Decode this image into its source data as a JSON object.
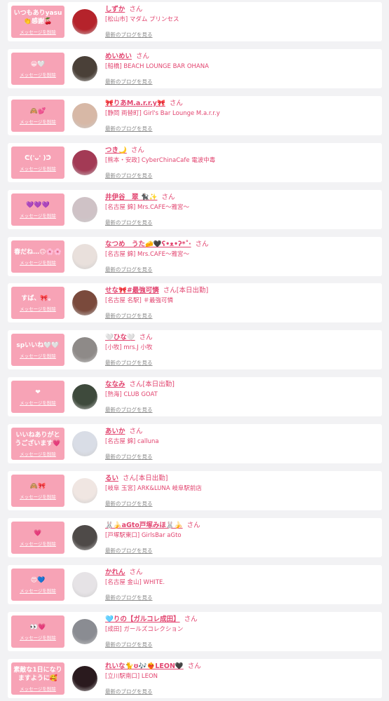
{
  "colors": {
    "page_bg": "#f2f2f4",
    "card_bg": "#ffffff",
    "badge_bg": "#f7a3b6",
    "accent": "#e2446f",
    "muted": "#8a8a8a"
  },
  "entries": [
    {
      "badge": "いつもありyasu👏感謝🍒",
      "delete_label": "メッセージを削除",
      "name": "しずか",
      "honorific": "さん",
      "shop": "[松山市] マダム プリンセス",
      "blog_label": "最新のブログを見る",
      "avatar_icon": "avatar-photo",
      "avatar_color": "#b5232b"
    },
    {
      "badge": "😀🤍",
      "delete_label": "メッセージを削除",
      "name": "めいめい",
      "honorific": "さん",
      "shop": "[船橋] BEACH LOUNGE BAR OHANA",
      "blog_label": "最新のブログを見る",
      "avatar_icon": "avatar-photo",
      "avatar_color": "#4a4038"
    },
    {
      "badge": "🙈💕",
      "delete_label": "メッセージを削除",
      "name": "🎀りあM.a.r.r.y🎀",
      "honorific": "さん",
      "shop": "[静岡 両替町] Girl's Bar Lounge M.a.r.r.y",
      "blog_label": "最新のブログを見る",
      "avatar_icon": "avatar-photo",
      "avatar_color": "#d7b8a6"
    },
    {
      "badge": "ᕦ('ᴗ' )ᕤ",
      "delete_label": "メッセージを削除",
      "name": "つき🌙",
      "honorific": "さん",
      "shop": "[熊本・安政] CyberChinaCafe 電波中毒",
      "blog_label": "最新のブログを見る",
      "avatar_icon": "avatar-photo",
      "avatar_color": "#a33a55"
    },
    {
      "badge": "💜💜💜",
      "delete_label": "メッセージを削除",
      "name": "井伊谷　翠 🐈‍⬛✨",
      "honorific": "さん",
      "shop": "[名古屋 錦] Mrs.CAFE〜雅宮〜",
      "blog_label": "最新のブログを見る",
      "avatar_icon": "avatar-photo",
      "avatar_color": "#cfc2c6"
    },
    {
      "badge": "春だね…🙃🌸🌸",
      "delete_label": "メッセージを削除",
      "name": "なつめ　うた🧀🖤ʕ•ᴥ•ʔ*˚‧",
      "honorific": "さん",
      "shop": "[名古屋 錦] Mrs.CAFE〜雅宮〜",
      "blog_label": "最新のブログを見る",
      "avatar_icon": "avatar-photo",
      "avatar_color": "#e9e0dc"
    },
    {
      "badge": "すば、🎀。",
      "delete_label": "メッセージを削除",
      "name": "せな🎀#最強可憐",
      "honorific": "さん[本日出勤]",
      "shop": "[名古屋 名駅] ＃最強可憐",
      "blog_label": "最新のブログを見る",
      "avatar_icon": "avatar-photo",
      "avatar_color": "#7a4a3c"
    },
    {
      "badge": "spいいね🤍🤍",
      "delete_label": "メッセージを削除",
      "name": "🤍ひな🤍",
      "honorific": "さん",
      "shop": "[小牧] mrs.J 小牧",
      "blog_label": "最新のブログを見る",
      "avatar_icon": "avatar-photo",
      "avatar_color": "#8e8a88"
    },
    {
      "badge": "❤",
      "delete_label": "メッセージを削除",
      "name": "ななみ",
      "honorific": "さん[本日出勤]",
      "shop": "[熱海] CLUB GOAT",
      "blog_label": "最新のブログを見る",
      "avatar_icon": "avatar-photo",
      "avatar_color": "#3e4a3c"
    },
    {
      "badge": "いいねありがとうございます💗",
      "delete_label": "メッセージを削除",
      "name": "あいか",
      "honorific": "さん",
      "shop": "[名古屋 錦] calluna",
      "blog_label": "最新のブログを見る",
      "avatar_icon": "avatar-photo",
      "avatar_color": "#d9dde6"
    },
    {
      "badge": "🙈🎀",
      "delete_label": "メッセージを削除",
      "name": "るい",
      "honorific": "さん[本日出勤]",
      "shop": "[岐阜 玉宮] ARK&LUNA 岐阜駅前店",
      "blog_label": "最新のブログを見る",
      "avatar_icon": "avatar-photo",
      "avatar_color": "#f0e6e2"
    },
    {
      "badge": "💗",
      "delete_label": "メッセージを削除",
      "name": "🐰🍌aGto戸塚みほ🐰🍌",
      "honorific": "さん",
      "shop": "[戸塚駅東口] GirlsBar aGto",
      "blog_label": "最新のブログを見る",
      "avatar_icon": "avatar-photo",
      "avatar_color": "#4e4a48"
    },
    {
      "badge": "😍💙",
      "delete_label": "メッセージを削除",
      "name": "かれん",
      "honorific": "さん",
      "shop": "[名古屋 金山] WHITE.",
      "blog_label": "最新のブログを見る",
      "avatar_icon": "avatar-photo",
      "avatar_color": "#e6e3e6"
    },
    {
      "badge": "👀💗",
      "delete_label": "メッセージを削除",
      "name": "🩵りの【ガルコレ成田】",
      "honorific": "さん",
      "shop": "[成田] ガールズコレクション",
      "blog_label": "最新のブログを見る",
      "avatar_icon": "avatar-photo",
      "avatar_color": "#8a8c92"
    },
    {
      "badge": "素敵な1日になりますように🥰",
      "delete_label": "メッセージを削除",
      "name": "れいな🐈ʊ🎶❤️‍🔥LEON🖤",
      "honorific": "さん",
      "shop": "[立川駅南口] LEON",
      "blog_label": "最新のブログを見る",
      "avatar_icon": "avatar-photo",
      "avatar_color": "#2a1a1e"
    }
  ]
}
